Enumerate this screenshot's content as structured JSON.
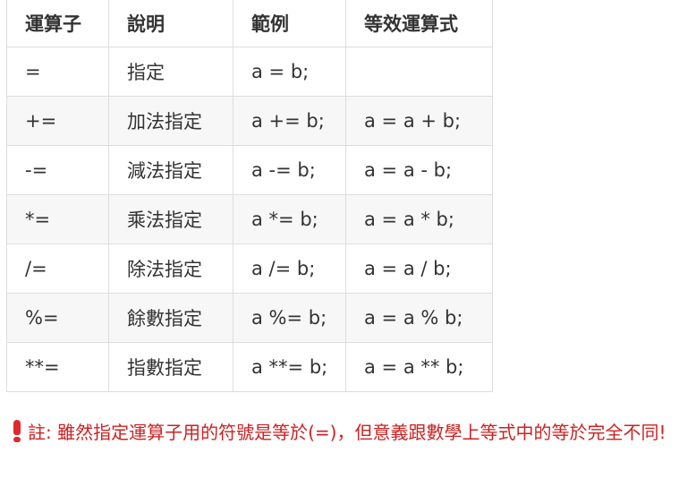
{
  "table": {
    "headers": [
      "運算子",
      "說明",
      "範例",
      "等效運算式"
    ],
    "rows": [
      [
        "=",
        "指定",
        "a = b;",
        ""
      ],
      [
        "+=",
        "加法指定",
        "a += b;",
        "a = a + b;"
      ],
      [
        "-=",
        "減法指定",
        "a -= b;",
        "a = a - b;"
      ],
      [
        "*=",
        "乘法指定",
        "a *= b;",
        "a = a * b;"
      ],
      [
        "/=",
        "除法指定",
        "a /= b;",
        "a = a / b;"
      ],
      [
        "%=",
        "餘數指定",
        "a %= b;",
        "a = a % b;"
      ],
      [
        "**=",
        "指數指定",
        "a **= b;",
        "a = a ** b;"
      ]
    ]
  },
  "note": {
    "icon": "exclamation-icon",
    "color": "#cc2222",
    "text": "註: 雖然指定運算子用的符號是等於(=)，但意義跟數學上等式中的等於完全不同!"
  }
}
